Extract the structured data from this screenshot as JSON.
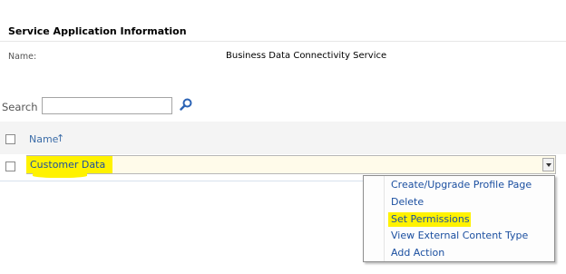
{
  "app_info": {
    "section_title": "Service Application Information",
    "name_label": "Name:",
    "name_value": "Business Data Connectivity Service"
  },
  "search": {
    "label": "Search",
    "value": "",
    "icon": "search-icon"
  },
  "table": {
    "column_header": "Name",
    "sort_indicator": "↑",
    "rows": [
      {
        "label": "Customer Data",
        "highlighted": true
      }
    ]
  },
  "context_menu": {
    "items": [
      {
        "label": "Create/Upgrade Profile Page"
      },
      {
        "label": "Delete"
      },
      {
        "label": "Set Permissions",
        "highlighted": true
      },
      {
        "label": "View External Content Type"
      },
      {
        "label": "Add Action"
      }
    ]
  },
  "colors": {
    "highlight": "#fff200",
    "link": "#1b4fa0",
    "header_band": "#f4f4f4"
  }
}
